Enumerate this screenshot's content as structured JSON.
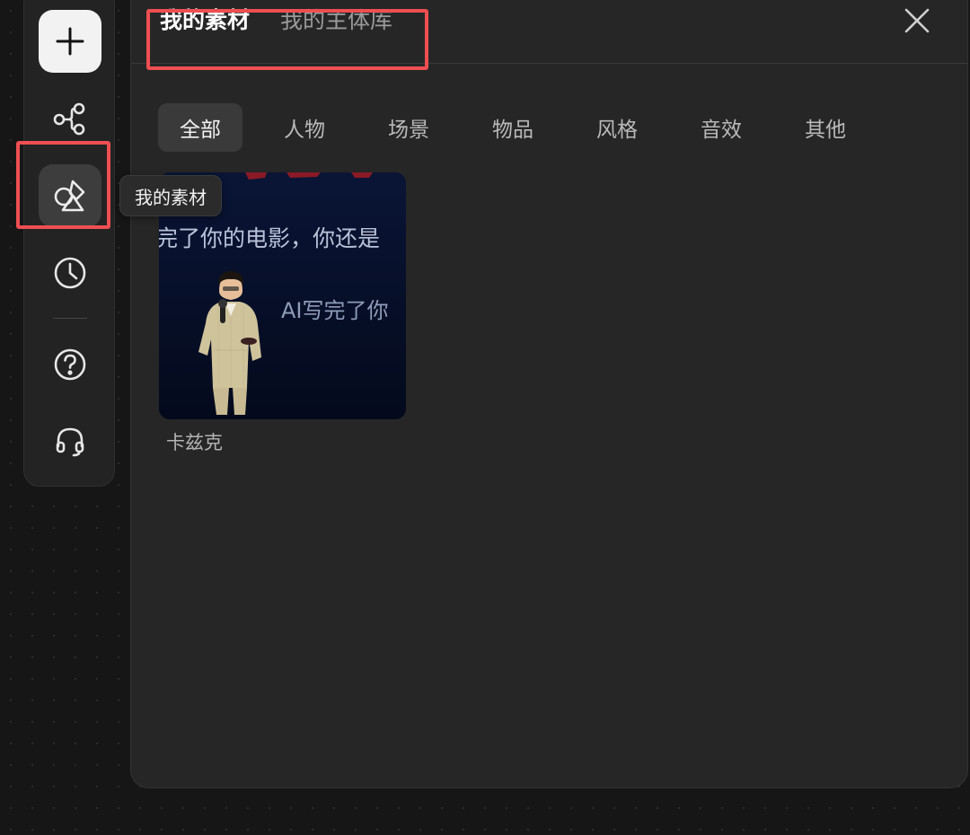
{
  "toolbar": {
    "items": [
      {
        "name": "add",
        "icon": "plus-icon"
      },
      {
        "name": "workflow",
        "icon": "nodes-icon"
      },
      {
        "name": "my-assets",
        "icon": "shapes-icon",
        "selected": true
      },
      {
        "name": "history",
        "icon": "clock-icon"
      },
      {
        "name": "help",
        "icon": "question-icon"
      },
      {
        "name": "support",
        "icon": "headset-icon"
      }
    ]
  },
  "tooltip": {
    "text": "我的素材"
  },
  "panel": {
    "tabs": [
      {
        "label": "我的素材",
        "active": true
      },
      {
        "label": "我的主体库",
        "active": false
      }
    ],
    "close_icon": "close-icon",
    "filters": [
      "全部",
      "人物",
      "场景",
      "物品",
      "风格",
      "音效",
      "其他"
    ],
    "active_filter": "全部",
    "assets": [
      {
        "name": "卡兹克",
        "thumbnail_text": [
          "完了你的电影，你还是",
          "AI写完了你"
        ]
      }
    ]
  },
  "colors": {
    "highlight": "#ee4f52",
    "panel_bg": "#262626",
    "toolbar_bg": "#232323",
    "thumbnail_bg": "#06102a"
  }
}
